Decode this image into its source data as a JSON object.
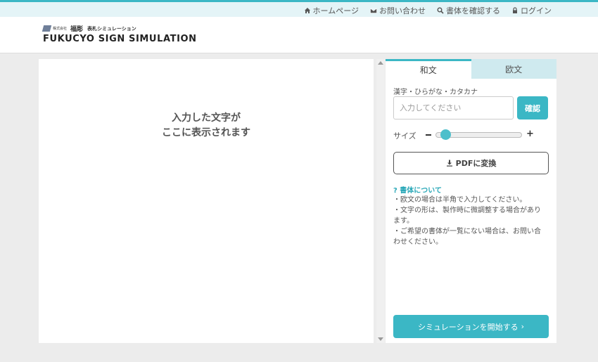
{
  "topnav": {
    "items": [
      {
        "icon": "home-icon",
        "label": "ホームページ"
      },
      {
        "icon": "envelope-icon",
        "label": "お問い合わせ"
      },
      {
        "icon": "search-icon",
        "label": "書体を確認する"
      },
      {
        "icon": "lock-icon",
        "label": "ログイン"
      }
    ]
  },
  "logo": {
    "corp": "株式会社",
    "brand": "福彫",
    "sub": "表札シミュレーション",
    "main": "FUKUCYO SIGN SIMULATION"
  },
  "preview": {
    "line1": "入力した文字が",
    "line2": "ここに表示されます"
  },
  "panel": {
    "tabs": [
      {
        "label": "和文",
        "active": true
      },
      {
        "label": "欧文",
        "active": false
      }
    ],
    "field_label": "漢字・ひらがな・カタカナ",
    "input": {
      "value": "",
      "placeholder": "入力してください"
    },
    "confirm_label": "確認",
    "size_label": "サイズ",
    "size_level": 0.1,
    "pdf_label": "PDFに変換",
    "about_title": "? 書体について",
    "notes": [
      "・欧文の場合は半角で入力してください。",
      "・文字の形は、製作時に微調整する場合があります。",
      "・ご希望の書体が一覧にない場合は、お問い合わせください。"
    ],
    "start_label": "シミュレーションを開始する",
    "start_arrow": "›"
  },
  "colors": {
    "accent": "#3bb7c5",
    "tab_inactive": "#cfeaef",
    "topbar": "#e4f4f7",
    "background": "#ececec"
  }
}
